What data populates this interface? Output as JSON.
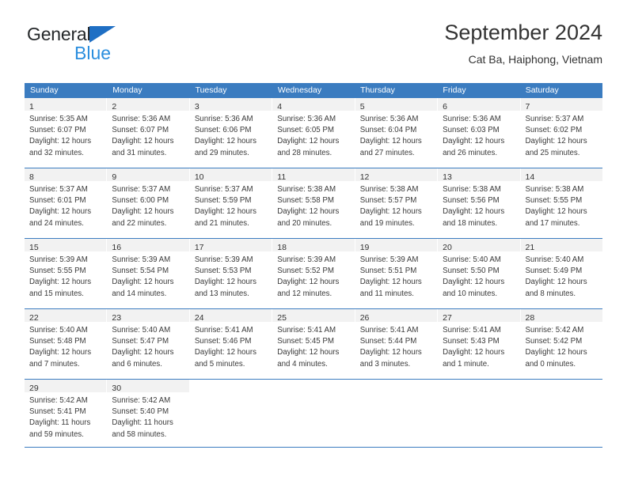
{
  "brand": {
    "name_part1": "General",
    "name_part2": "Blue",
    "triangle_color": "#1f6fc4",
    "blue_text_color": "#2a8ede"
  },
  "header": {
    "month_title": "September 2024",
    "location": "Cat Ba, Haiphong, Vietnam",
    "header_bg_color": "#3b7cc0",
    "header_text_color": "#ffffff"
  },
  "weekdays": [
    "Sunday",
    "Monday",
    "Tuesday",
    "Wednesday",
    "Thursday",
    "Friday",
    "Saturday"
  ],
  "weeks": [
    {
      "days": [
        {
          "daynum": "1",
          "sunrise": "Sunrise: 5:35 AM",
          "sunset": "Sunset: 6:07 PM",
          "daylight1": "Daylight: 12 hours",
          "daylight2": "and 32 minutes."
        },
        {
          "daynum": "2",
          "sunrise": "Sunrise: 5:36 AM",
          "sunset": "Sunset: 6:07 PM",
          "daylight1": "Daylight: 12 hours",
          "daylight2": "and 31 minutes."
        },
        {
          "daynum": "3",
          "sunrise": "Sunrise: 5:36 AM",
          "sunset": "Sunset: 6:06 PM",
          "daylight1": "Daylight: 12 hours",
          "daylight2": "and 29 minutes."
        },
        {
          "daynum": "4",
          "sunrise": "Sunrise: 5:36 AM",
          "sunset": "Sunset: 6:05 PM",
          "daylight1": "Daylight: 12 hours",
          "daylight2": "and 28 minutes."
        },
        {
          "daynum": "5",
          "sunrise": "Sunrise: 5:36 AM",
          "sunset": "Sunset: 6:04 PM",
          "daylight1": "Daylight: 12 hours",
          "daylight2": "and 27 minutes."
        },
        {
          "daynum": "6",
          "sunrise": "Sunrise: 5:36 AM",
          "sunset": "Sunset: 6:03 PM",
          "daylight1": "Daylight: 12 hours",
          "daylight2": "and 26 minutes."
        },
        {
          "daynum": "7",
          "sunrise": "Sunrise: 5:37 AM",
          "sunset": "Sunset: 6:02 PM",
          "daylight1": "Daylight: 12 hours",
          "daylight2": "and 25 minutes."
        }
      ]
    },
    {
      "days": [
        {
          "daynum": "8",
          "sunrise": "Sunrise: 5:37 AM",
          "sunset": "Sunset: 6:01 PM",
          "daylight1": "Daylight: 12 hours",
          "daylight2": "and 24 minutes."
        },
        {
          "daynum": "9",
          "sunrise": "Sunrise: 5:37 AM",
          "sunset": "Sunset: 6:00 PM",
          "daylight1": "Daylight: 12 hours",
          "daylight2": "and 22 minutes."
        },
        {
          "daynum": "10",
          "sunrise": "Sunrise: 5:37 AM",
          "sunset": "Sunset: 5:59 PM",
          "daylight1": "Daylight: 12 hours",
          "daylight2": "and 21 minutes."
        },
        {
          "daynum": "11",
          "sunrise": "Sunrise: 5:38 AM",
          "sunset": "Sunset: 5:58 PM",
          "daylight1": "Daylight: 12 hours",
          "daylight2": "and 20 minutes."
        },
        {
          "daynum": "12",
          "sunrise": "Sunrise: 5:38 AM",
          "sunset": "Sunset: 5:57 PM",
          "daylight1": "Daylight: 12 hours",
          "daylight2": "and 19 minutes."
        },
        {
          "daynum": "13",
          "sunrise": "Sunrise: 5:38 AM",
          "sunset": "Sunset: 5:56 PM",
          "daylight1": "Daylight: 12 hours",
          "daylight2": "and 18 minutes."
        },
        {
          "daynum": "14",
          "sunrise": "Sunrise: 5:38 AM",
          "sunset": "Sunset: 5:55 PM",
          "daylight1": "Daylight: 12 hours",
          "daylight2": "and 17 minutes."
        }
      ]
    },
    {
      "days": [
        {
          "daynum": "15",
          "sunrise": "Sunrise: 5:39 AM",
          "sunset": "Sunset: 5:55 PM",
          "daylight1": "Daylight: 12 hours",
          "daylight2": "and 15 minutes."
        },
        {
          "daynum": "16",
          "sunrise": "Sunrise: 5:39 AM",
          "sunset": "Sunset: 5:54 PM",
          "daylight1": "Daylight: 12 hours",
          "daylight2": "and 14 minutes."
        },
        {
          "daynum": "17",
          "sunrise": "Sunrise: 5:39 AM",
          "sunset": "Sunset: 5:53 PM",
          "daylight1": "Daylight: 12 hours",
          "daylight2": "and 13 minutes."
        },
        {
          "daynum": "18",
          "sunrise": "Sunrise: 5:39 AM",
          "sunset": "Sunset: 5:52 PM",
          "daylight1": "Daylight: 12 hours",
          "daylight2": "and 12 minutes."
        },
        {
          "daynum": "19",
          "sunrise": "Sunrise: 5:39 AM",
          "sunset": "Sunset: 5:51 PM",
          "daylight1": "Daylight: 12 hours",
          "daylight2": "and 11 minutes."
        },
        {
          "daynum": "20",
          "sunrise": "Sunrise: 5:40 AM",
          "sunset": "Sunset: 5:50 PM",
          "daylight1": "Daylight: 12 hours",
          "daylight2": "and 10 minutes."
        },
        {
          "daynum": "21",
          "sunrise": "Sunrise: 5:40 AM",
          "sunset": "Sunset: 5:49 PM",
          "daylight1": "Daylight: 12 hours",
          "daylight2": "and 8 minutes."
        }
      ]
    },
    {
      "days": [
        {
          "daynum": "22",
          "sunrise": "Sunrise: 5:40 AM",
          "sunset": "Sunset: 5:48 PM",
          "daylight1": "Daylight: 12 hours",
          "daylight2": "and 7 minutes."
        },
        {
          "daynum": "23",
          "sunrise": "Sunrise: 5:40 AM",
          "sunset": "Sunset: 5:47 PM",
          "daylight1": "Daylight: 12 hours",
          "daylight2": "and 6 minutes."
        },
        {
          "daynum": "24",
          "sunrise": "Sunrise: 5:41 AM",
          "sunset": "Sunset: 5:46 PM",
          "daylight1": "Daylight: 12 hours",
          "daylight2": "and 5 minutes."
        },
        {
          "daynum": "25",
          "sunrise": "Sunrise: 5:41 AM",
          "sunset": "Sunset: 5:45 PM",
          "daylight1": "Daylight: 12 hours",
          "daylight2": "and 4 minutes."
        },
        {
          "daynum": "26",
          "sunrise": "Sunrise: 5:41 AM",
          "sunset": "Sunset: 5:44 PM",
          "daylight1": "Daylight: 12 hours",
          "daylight2": "and 3 minutes."
        },
        {
          "daynum": "27",
          "sunrise": "Sunrise: 5:41 AM",
          "sunset": "Sunset: 5:43 PM",
          "daylight1": "Daylight: 12 hours",
          "daylight2": "and 1 minute."
        },
        {
          "daynum": "28",
          "sunrise": "Sunrise: 5:42 AM",
          "sunset": "Sunset: 5:42 PM",
          "daylight1": "Daylight: 12 hours",
          "daylight2": "and 0 minutes."
        }
      ]
    },
    {
      "days": [
        {
          "daynum": "29",
          "sunrise": "Sunrise: 5:42 AM",
          "sunset": "Sunset: 5:41 PM",
          "daylight1": "Daylight: 11 hours",
          "daylight2": "and 59 minutes."
        },
        {
          "daynum": "30",
          "sunrise": "Sunrise: 5:42 AM",
          "sunset": "Sunset: 5:40 PM",
          "daylight1": "Daylight: 11 hours",
          "daylight2": "and 58 minutes."
        },
        {
          "daynum": "",
          "sunrise": "",
          "sunset": "",
          "daylight1": "",
          "daylight2": ""
        },
        {
          "daynum": "",
          "sunrise": "",
          "sunset": "",
          "daylight1": "",
          "daylight2": ""
        },
        {
          "daynum": "",
          "sunrise": "",
          "sunset": "",
          "daylight1": "",
          "daylight2": ""
        },
        {
          "daynum": "",
          "sunrise": "",
          "sunset": "",
          "daylight1": "",
          "daylight2": ""
        },
        {
          "daynum": "",
          "sunrise": "",
          "sunset": "",
          "daylight1": "",
          "daylight2": ""
        }
      ]
    }
  ]
}
